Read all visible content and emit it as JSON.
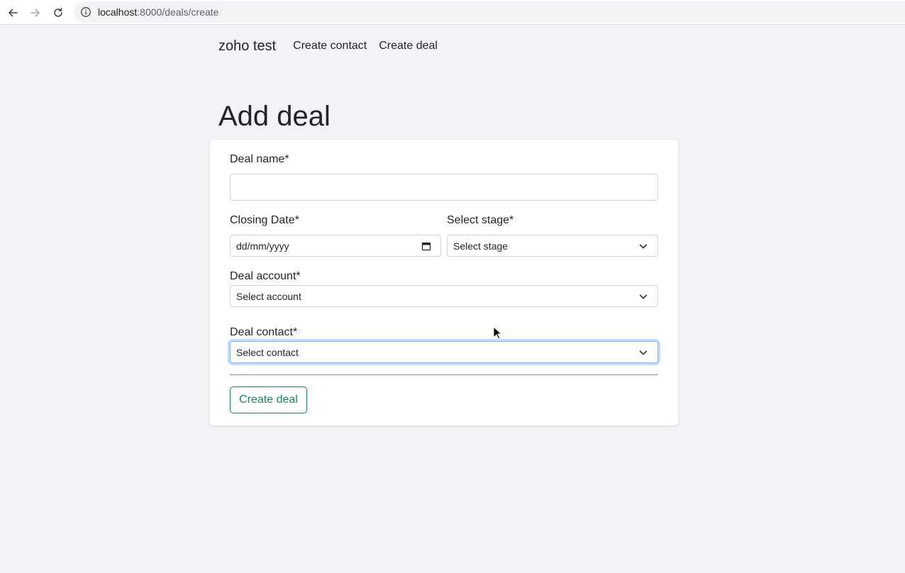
{
  "browser": {
    "url_host": "localhost",
    "url_path": ":8000/deals/create"
  },
  "nav": {
    "brand": "zoho test",
    "links": [
      "Create contact",
      "Create deal"
    ]
  },
  "page": {
    "title": "Add deal"
  },
  "form": {
    "deal_name_label": "Deal name*",
    "deal_name_value": "",
    "closing_date_label": "Closing Date*",
    "closing_date_placeholder": "dd/mm/yyyy",
    "stage_label": "Select stage*",
    "stage_value": "Select stage",
    "account_label": "Deal account*",
    "account_value": "Select account",
    "contact_label": "Deal contact*",
    "contact_value": "Select contact",
    "submit_label": "Create deal"
  },
  "colors": {
    "page_bg": "#f3f3f7",
    "submit_accent": "#198754",
    "focus_border": "#86b7fe"
  },
  "icons": [
    "back-arrow-icon",
    "forward-arrow-icon",
    "reload-icon",
    "info-icon",
    "calendar-icon",
    "chevron-down-icon",
    "mouse-cursor-icon"
  ]
}
